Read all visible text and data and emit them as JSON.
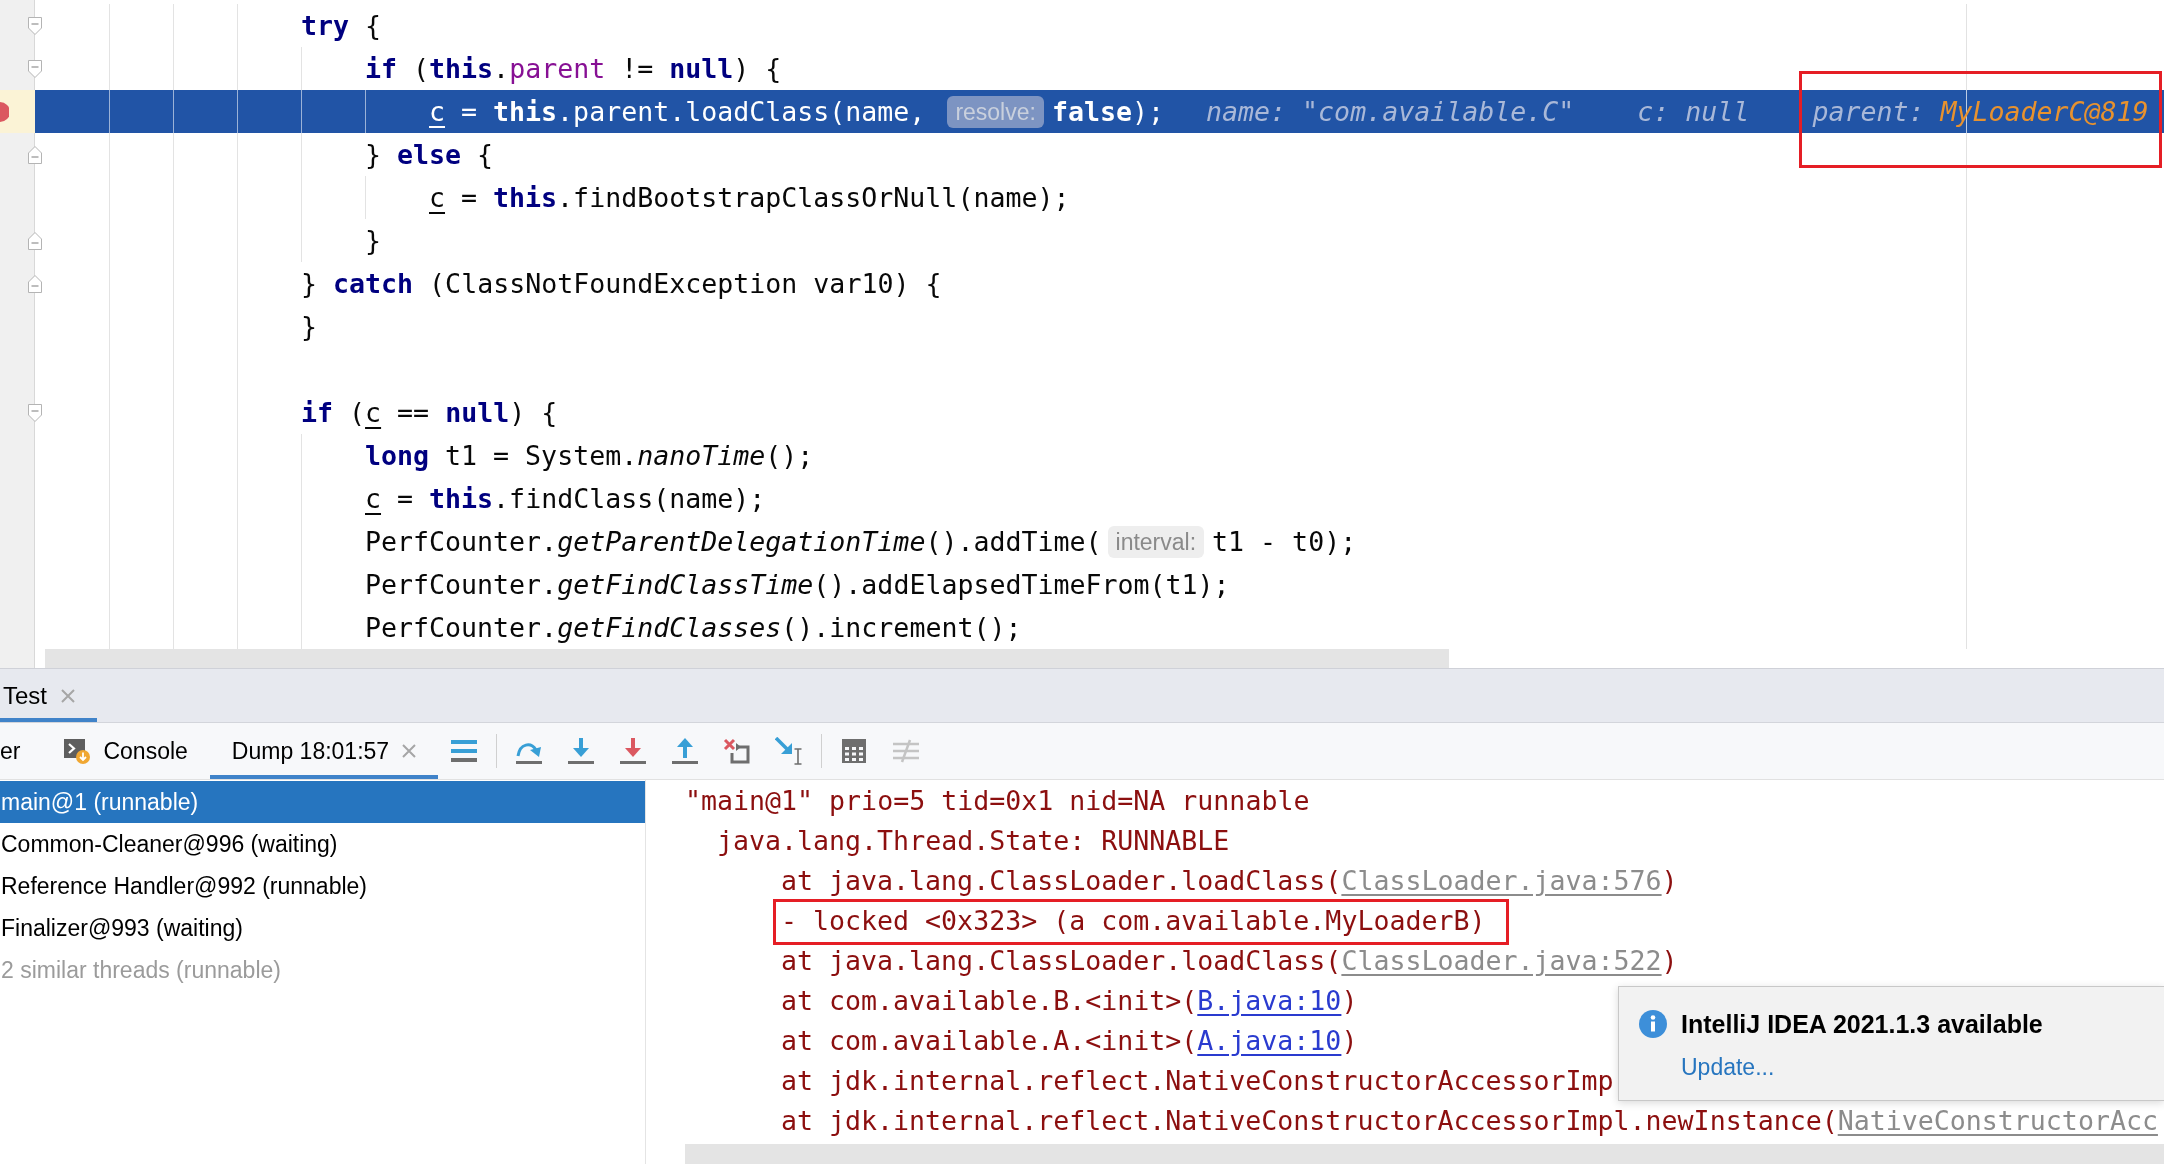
{
  "editor": {
    "lines": [
      {
        "kind": "code",
        "current": false,
        "fold": {
          "kind": "start"
        },
        "tokens": [
          {
            "text": "try",
            "kind": "keyword"
          },
          {
            "text": " {",
            "kind": "plain"
          }
        ],
        "children": [
          {
            "kind": "code",
            "current": false,
            "fold": {
              "kind": "start"
            },
            "tokens": [
              {
                "text": "if",
                "kind": "keyword"
              },
              {
                "text": " (",
                "kind": "plain"
              },
              {
                "text": "this",
                "kind": "keyword"
              },
              {
                "text": ".",
                "kind": "plain"
              },
              {
                "text": "parent",
                "kind": "field"
              },
              {
                "text": " != ",
                "kind": "plain"
              },
              {
                "text": "null",
                "kind": "keyword"
              },
              {
                "text": ") {",
                "kind": "plain"
              }
            ],
            "children": [
              {
                "kind": "code",
                "current": true,
                "tokens": [
                  {
                    "text": "c",
                    "kind": "reassigned"
                  },
                  {
                    "text": " = ",
                    "kind": "plain"
                  },
                  {
                    "text": "this",
                    "kind": "keyword"
                  },
                  {
                    "text": ".parent.loadClass(name, ",
                    "kind": "plain"
                  },
                  {
                    "text": "resolve:",
                    "kind": "hint"
                  },
                  {
                    "text": "false",
                    "kind": "keyword"
                  },
                  {
                    "text": ");",
                    "kind": "plain"
                  }
                ],
                "inline_values": [
                  {
                    "name": "name:",
                    "value": "\"com.available.C\"",
                    "changed": false,
                    "annotated": false
                  },
                  {
                    "name": "c:",
                    "value": "null",
                    "changed": false,
                    "annotated": false
                  },
                  {
                    "name": "parent:",
                    "value": "MyLoaderC@819",
                    "changed": true,
                    "annotated": true
                  }
                ]
              }
            ]
          },
          {
            "kind": "code",
            "current": false,
            "fold": {
              "kind": "end"
            },
            "tokens": [
              {
                "text": "} ",
                "kind": "plain"
              },
              {
                "text": "else",
                "kind": "keyword"
              },
              {
                "text": " {",
                "kind": "plain"
              }
            ],
            "children": [
              {
                "kind": "code",
                "current": false,
                "tokens": [
                  {
                    "text": "c",
                    "kind": "reassigned"
                  },
                  {
                    "text": " = ",
                    "kind": "plain"
                  },
                  {
                    "text": "this",
                    "kind": "keyword"
                  },
                  {
                    "text": ".findBootstrapClassOrNull(name);",
                    "kind": "plain"
                  }
                ]
              }
            ]
          },
          {
            "kind": "code",
            "current": false,
            "fold": {
              "kind": "end"
            },
            "tokens": [
              {
                "text": "}",
                "kind": "plain"
              }
            ]
          }
        ]
      },
      {
        "kind": "code",
        "current": false,
        "fold": {
          "kind": "end"
        },
        "tokens": [
          {
            "text": "} ",
            "kind": "plain"
          },
          {
            "text": "catch",
            "kind": "keyword"
          },
          {
            "text": " (ClassNotFoundException var10) {",
            "kind": "plain"
          }
        ]
      },
      {
        "kind": "code",
        "current": false,
        "tokens": [
          {
            "text": "}",
            "kind": "plain"
          }
        ]
      },
      {
        "kind": "blank",
        "current": false
      },
      {
        "kind": "code",
        "current": false,
        "fold": {
          "kind": "start"
        },
        "tokens": [
          {
            "text": "if",
            "kind": "keyword"
          },
          {
            "text": " (",
            "kind": "plain"
          },
          {
            "text": "c",
            "kind": "reassigned"
          },
          {
            "text": " == ",
            "kind": "plain"
          },
          {
            "text": "null",
            "kind": "keyword"
          },
          {
            "text": ") {",
            "kind": "plain"
          }
        ],
        "children": [
          {
            "kind": "code",
            "current": false,
            "tokens": [
              {
                "text": "long",
                "kind": "keyword"
              },
              {
                "text": " t1 = System.",
                "kind": "plain"
              },
              {
                "text": "nanoTime",
                "kind": "static"
              },
              {
                "text": "();",
                "kind": "plain"
              }
            ]
          },
          {
            "kind": "code",
            "current": false,
            "tokens": [
              {
                "text": "c",
                "kind": "reassigned"
              },
              {
                "text": " = ",
                "kind": "plain"
              },
              {
                "text": "this",
                "kind": "keyword"
              },
              {
                "text": ".findClass(name);",
                "kind": "plain"
              }
            ]
          },
          {
            "kind": "code",
            "current": false,
            "tokens": [
              {
                "text": "PerfCounter.",
                "kind": "plain"
              },
              {
                "text": "getParentDelegationTime",
                "kind": "static"
              },
              {
                "text": "().addTime(",
                "kind": "plain"
              },
              {
                "text": "interval:",
                "kind": "hint"
              },
              {
                "text": "t1 - t0);",
                "kind": "plain"
              }
            ]
          },
          {
            "kind": "code",
            "current": false,
            "tokens": [
              {
                "text": "PerfCounter.",
                "kind": "plain"
              },
              {
                "text": "getFindClassTime",
                "kind": "static"
              },
              {
                "text": "().addElapsedTimeFrom(t1);",
                "kind": "plain"
              }
            ]
          },
          {
            "kind": "code",
            "current": false,
            "tokens": [
              {
                "text": "PerfCounter.",
                "kind": "plain"
              },
              {
                "text": "getFindClasses",
                "kind": "static"
              },
              {
                "text": "().increment();",
                "kind": "plain"
              }
            ]
          }
        ]
      }
    ]
  },
  "tool_window": {
    "tabs": [
      {
        "label": "Test",
        "selected": true,
        "closable": true
      }
    ]
  },
  "debug_tabs": [
    {
      "label": "er",
      "selected": false,
      "with_icon": false,
      "closable": false
    },
    {
      "label": "Console",
      "selected": false,
      "with_icon": true,
      "closable": false
    },
    {
      "label": "Dump 18:01:57",
      "selected": true,
      "with_icon": false,
      "closable": true
    }
  ],
  "toolbar": {
    "groups": [
      {
        "buttons": [
          {
            "kind": "lines",
            "disabled": false
          }
        ]
      },
      {
        "buttons": [
          {
            "kind": "arc",
            "disabled": false
          },
          {
            "kind": "down",
            "disabled": false
          },
          {
            "kind": "forcedown",
            "disabled": false
          },
          {
            "kind": "up",
            "disabled": false
          },
          {
            "kind": "drop",
            "disabled": false
          },
          {
            "kind": "cursor",
            "disabled": false
          }
        ]
      },
      {
        "buttons": [
          {
            "kind": "grid",
            "disabled": false
          },
          {
            "kind": "trace",
            "disabled": true
          }
        ]
      }
    ]
  },
  "threads": [
    {
      "label": "main@1 (runnable)",
      "selected": true,
      "dimmed": false
    },
    {
      "label": "Common-Cleaner@996 (waiting)",
      "selected": false,
      "dimmed": false
    },
    {
      "label": "Reference Handler@992 (runnable)",
      "selected": false,
      "dimmed": false
    },
    {
      "label": "Finalizer@993 (waiting)",
      "selected": false,
      "dimmed": false
    },
    {
      "label": "2 similar threads (runnable)",
      "selected": false,
      "dimmed": true
    }
  ],
  "dump": {
    "lines": [
      {
        "kind": "thread",
        "annotated": false,
        "tokens": [
          {
            "text": "\"main@1\" prio=5 tid=0x1 nid=NA runnable",
            "kind": "plain"
          }
        ]
      },
      {
        "kind": "state",
        "annotated": false,
        "tokens": [
          {
            "text": "java.lang.Thread.State: RUNNABLE",
            "kind": "plain"
          }
        ]
      },
      {
        "kind": "frame",
        "annotated": false,
        "tokens": [
          {
            "text": "at java.lang.ClassLoader.loadClass(",
            "kind": "plain"
          },
          {
            "text": "ClassLoader.java:576",
            "kind": "library-link"
          },
          {
            "text": ")",
            "kind": "plain"
          }
        ]
      },
      {
        "kind": "lock",
        "annotated": true,
        "tokens": [
          {
            "text": "- locked <0x323> (a com.available.MyLoaderB)",
            "kind": "plain"
          }
        ]
      },
      {
        "kind": "frame",
        "annotated": false,
        "tokens": [
          {
            "text": "at java.lang.ClassLoader.loadClass(",
            "kind": "plain"
          },
          {
            "text": "ClassLoader.java:522",
            "kind": "library-link"
          },
          {
            "text": ")",
            "kind": "plain"
          }
        ]
      },
      {
        "kind": "frame",
        "annotated": false,
        "tokens": [
          {
            "text": "at com.available.B.<init>(",
            "kind": "plain"
          },
          {
            "text": "B.java:10",
            "kind": "source-link"
          },
          {
            "text": ")",
            "kind": "plain"
          }
        ]
      },
      {
        "kind": "frame",
        "annotated": false,
        "tokens": [
          {
            "text": "at com.available.A.<init>(",
            "kind": "plain"
          },
          {
            "text": "A.java:10",
            "kind": "source-link"
          },
          {
            "text": ")",
            "kind": "plain"
          }
        ]
      },
      {
        "kind": "frame",
        "annotated": false,
        "tokens": [
          {
            "text": "at jdk.internal.reflect.NativeConstructorAccessorImp",
            "kind": "plain"
          }
        ]
      },
      {
        "kind": "frame",
        "annotated": false,
        "tokens": [
          {
            "text": "at jdk.internal.reflect.NativeConstructorAccessorImpl.newInstance(",
            "kind": "plain"
          },
          {
            "text": "NativeConstructorAcc",
            "kind": "library-link"
          }
        ]
      }
    ]
  },
  "notification": {
    "title": "IntelliJ IDEA 2021.1.3 available",
    "link": "Update..."
  }
}
